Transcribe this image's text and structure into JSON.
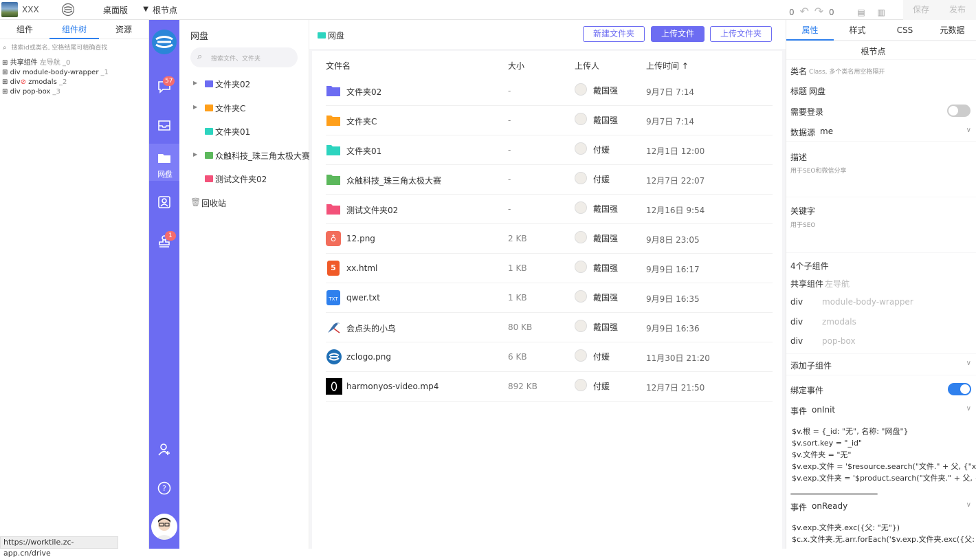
{
  "topbar": {
    "app_name": "XXX",
    "device": "桌面版",
    "crumb": "根节点",
    "undo_count": "0",
    "redo_count": "0",
    "save": "保存",
    "publish": "发布"
  },
  "left": {
    "tabs": [
      "组件",
      "组件树",
      "资源"
    ],
    "search_placeholder": "搜索id或类名, 空格结尾可精确查找",
    "tree": [
      {
        "tag": "共享组件",
        "name": "左导航",
        "idx": "_0"
      },
      {
        "tag": "div",
        "name": "module-body-wrapper",
        "idx": "_1"
      },
      {
        "tag": "div",
        "name": "zmodals",
        "idx": "_2"
      },
      {
        "tag": "div",
        "name": "pop-box",
        "idx": "_3"
      }
    ],
    "status_url": "https://worktile.zc-app.cn/drive"
  },
  "vnav": {
    "msg_badge": "57",
    "drive_label": "网盘",
    "stamp_badge": "1"
  },
  "folders": {
    "title": "网盘",
    "search_placeholder": "搜索文件、文件夹",
    "items": [
      {
        "name": "文件夹02",
        "color": "#6c6cf2",
        "expandable": true
      },
      {
        "name": "文件夹C",
        "color": "#ff9f1a",
        "expandable": true
      },
      {
        "name": "文件夹01",
        "color": "#2dd4bf",
        "expandable": false
      },
      {
        "name": "众触科技_珠三角太极大赛",
        "color": "#5cb85c",
        "expandable": true
      },
      {
        "name": "测试文件夹02",
        "color": "#f3527a",
        "expandable": false
      }
    ],
    "recycle": "回收站"
  },
  "main": {
    "crumb": "网盘",
    "buttons": {
      "new_folder": "新建文件夹",
      "upload_file": "上传文件",
      "upload_folder": "上传文件夹"
    },
    "columns": {
      "name": "文件名",
      "size": "大小",
      "uploader": "上传人",
      "time": "上传时间 ↑"
    },
    "files": [
      {
        "name": "文件夹02",
        "size": "-",
        "uploader": "戴国强",
        "time": "9月7日 7:14",
        "icon": "folder-icon",
        "color": "#6c6cf2"
      },
      {
        "name": "文件夹C",
        "size": "-",
        "uploader": "戴国强",
        "time": "9月7日 7:14",
        "icon": "folder-icon",
        "color": "#ff9f1a"
      },
      {
        "name": "文件夹01",
        "size": "-",
        "uploader": "付媛",
        "time": "12月1日 12:00",
        "icon": "folder-icon",
        "color": "#2dd4bf"
      },
      {
        "name": "众触科技_珠三角太极大赛",
        "size": "-",
        "uploader": "付媛",
        "time": "12月7日 22:07",
        "icon": "folder-icon",
        "color": "#5cb85c"
      },
      {
        "name": "测试文件夹02",
        "size": "-",
        "uploader": "戴国强",
        "time": "12月16日 9:54",
        "icon": "folder-icon",
        "color": "#f3527a"
      },
      {
        "name": "12.png",
        "size": "2 KB",
        "uploader": "戴国强",
        "time": "9月8日 23:05",
        "icon": "image-file-icon",
        "color": "#f26d5b"
      },
      {
        "name": "xx.html",
        "size": "1 KB",
        "uploader": "戴国强",
        "time": "9月9日 16:17",
        "icon": "html-file-icon",
        "color": "#f05a28"
      },
      {
        "name": "qwer.txt",
        "size": "1 KB",
        "uploader": "戴国强",
        "time": "9月9日 16:35",
        "icon": "txt-file-icon",
        "color": "#2f80ed"
      },
      {
        "name": "会点头的小鸟",
        "size": "80 KB",
        "uploader": "戴国强",
        "time": "9月9日 16:36",
        "icon": "bird-thumb-icon",
        "color": "#3b6ea8"
      },
      {
        "name": "zclogo.png",
        "size": "6 KB",
        "uploader": "付媛",
        "time": "11月30日 21:20",
        "icon": "zc-logo-icon",
        "color": "#1f6fb5"
      },
      {
        "name": "harmonyos-video.mp4",
        "size": "892 KB",
        "uploader": "付媛",
        "time": "12月7日 21:50",
        "icon": "video-thumb-icon",
        "color": "#000000"
      }
    ]
  },
  "right": {
    "tabs": [
      "属性",
      "样式",
      "CSS",
      "元数据"
    ],
    "node_title": "根节点",
    "class_label": "类名",
    "class_hint": "Class, 多个类名用空格隔开",
    "title_label": "标题",
    "title_value": "网盘",
    "login_label": "需要登录",
    "datasource_label": "数据源",
    "datasource_value": "me",
    "desc_label": "描述",
    "desc_hint": "用于SEO和微信分享",
    "keywords_label": "关键字",
    "keywords_hint": "用于SEO",
    "children_title": "4个子组件",
    "children": [
      {
        "tag": "共享组件",
        "name": "左导航"
      },
      {
        "tag": "div",
        "name": "module-body-wrapper"
      },
      {
        "tag": "div",
        "name": "zmodals"
      },
      {
        "tag": "div",
        "name": "pop-box"
      }
    ],
    "add_child": "添加子组件",
    "bind_events": "绑定事件",
    "event1_label": "事件",
    "event1_name": "onInit",
    "event1_code": [
      "$v.根 = {_id: \"无\", 名称: \"网盘\"}",
      "$v.sort.key = \"_id\"",
      "$v.文件夹 = \"无\"",
      "$v.exp.文件 = '$resource.search(\"文件.\" + 父, {\"x.类型",
      "$v.exp.文件夹 = '$product.search(\"文件夹.\" + 父, {ty"
    ],
    "event2_label": "事件",
    "event2_name": "onReady",
    "event2_code": [
      "$v.exp.文件夹.exc({父: \"无\"})",
      "$c.x.文件夹.无.arr.forEach('$v.exp.文件夹.exc({父: $x."
    ],
    "accent": "#2f80ed"
  }
}
